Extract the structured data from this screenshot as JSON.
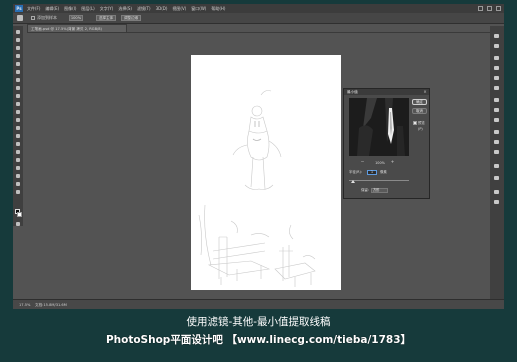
{
  "app": {
    "logo": "Ps",
    "menu": [
      "文件(F)",
      "编辑(E)",
      "图像(I)",
      "图层(L)",
      "文字(Y)",
      "选择(S)",
      "滤镜(T)",
      "3D(D)",
      "视图(V)",
      "窗口(W)",
      "帮助(H)"
    ]
  },
  "options_bar": {
    "checkbox_label": "添加到样本",
    "value": "100%",
    "button1": "选择主体",
    "button2": "调整边缘"
  },
  "document_tab": {
    "title": "工笔画.psd @ 17.5%(背景 拷贝 2, RGB/8)"
  },
  "status_bar": {
    "zoom": "17.5%",
    "doc": "文档:15.8M/31.6M"
  },
  "minimum_dialog": {
    "title": "最小值",
    "ok_label": "确定",
    "cancel_label": "取消",
    "preview_label": "预览(P)",
    "zoom_value": "100%",
    "zoom_out_icon": "zoom-out-icon",
    "zoom_in_icon": "zoom-in-icon",
    "radius_label": "半径(R):",
    "radius_value": "1",
    "radius_unit": "像素",
    "keep_label": "保留:",
    "keep_value": "方形"
  },
  "caption": {
    "line1": "使用滤镜-其他-最小值提取线稿",
    "line2": "PhotoShop平面设计吧 【www.linecg.com/tieba/1783】"
  },
  "colors": {
    "frame": "#163a3b",
    "workspace": "#535353",
    "panel": "#3f3f3f"
  }
}
